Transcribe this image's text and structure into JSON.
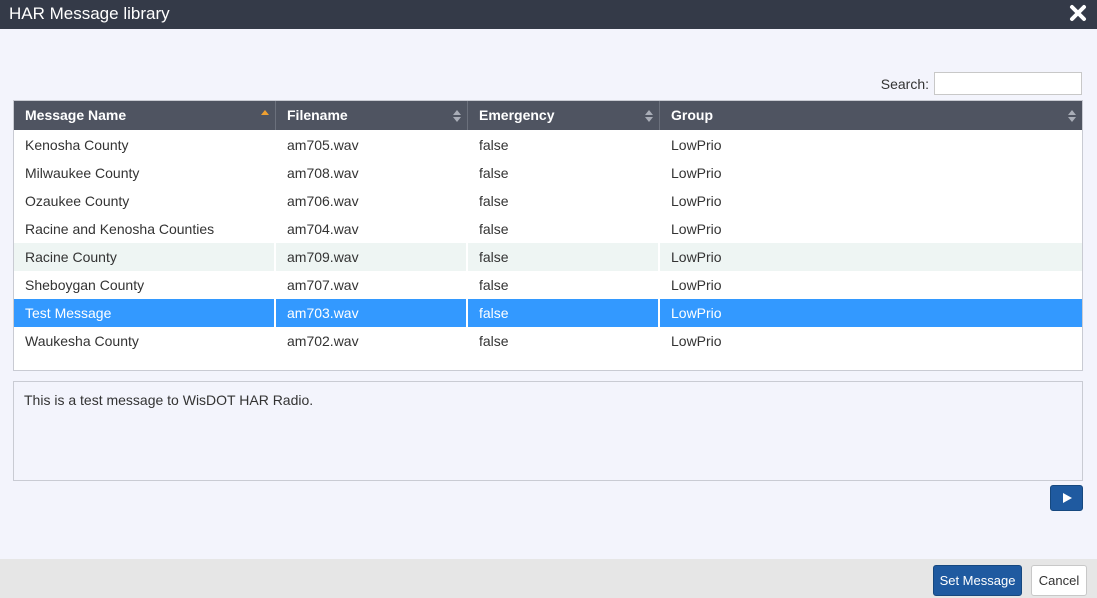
{
  "window": {
    "title": "HAR Message library",
    "close_icon": "close-icon"
  },
  "search": {
    "label": "Search:",
    "value": "",
    "placeholder": ""
  },
  "table": {
    "columns": [
      {
        "label": "Message Name",
        "sort": "ascending"
      },
      {
        "label": "Filename",
        "sort": "none"
      },
      {
        "label": "Emergency",
        "sort": "none"
      },
      {
        "label": "Group",
        "sort": "none"
      }
    ],
    "rows": [
      {
        "name": "Kenosha County",
        "filename": "am705.wav",
        "emergency": "false",
        "group": "LowPrio"
      },
      {
        "name": "Milwaukee County",
        "filename": "am708.wav",
        "emergency": "false",
        "group": "LowPrio"
      },
      {
        "name": "Ozaukee County",
        "filename": "am706.wav",
        "emergency": "false",
        "group": "LowPrio"
      },
      {
        "name": "Racine and Kenosha Counties",
        "filename": "am704.wav",
        "emergency": "false",
        "group": "LowPrio"
      },
      {
        "name": "Racine County",
        "filename": "am709.wav",
        "emergency": "false",
        "group": "LowPrio"
      },
      {
        "name": "Sheboygan County",
        "filename": "am707.wav",
        "emergency": "false",
        "group": "LowPrio"
      },
      {
        "name": "Test Message",
        "filename": "am703.wav",
        "emergency": "false",
        "group": "LowPrio"
      },
      {
        "name": "Waukesha County",
        "filename": "am702.wav",
        "emergency": "false",
        "group": "LowPrio"
      }
    ],
    "hovered_row": "Racine County",
    "selected_row": "Test Message"
  },
  "description": {
    "text": "This is a test message to WisDOT HAR Radio."
  },
  "play_button": {
    "icon": "play-icon"
  },
  "footer": {
    "set_label": "Set Message",
    "cancel_label": "Cancel"
  },
  "colors": {
    "titlebar": "#343a48",
    "header": "#4f5461",
    "selected": "#3399ff",
    "primary_button": "#1f5aa0",
    "sort_active": "#f0a030"
  }
}
